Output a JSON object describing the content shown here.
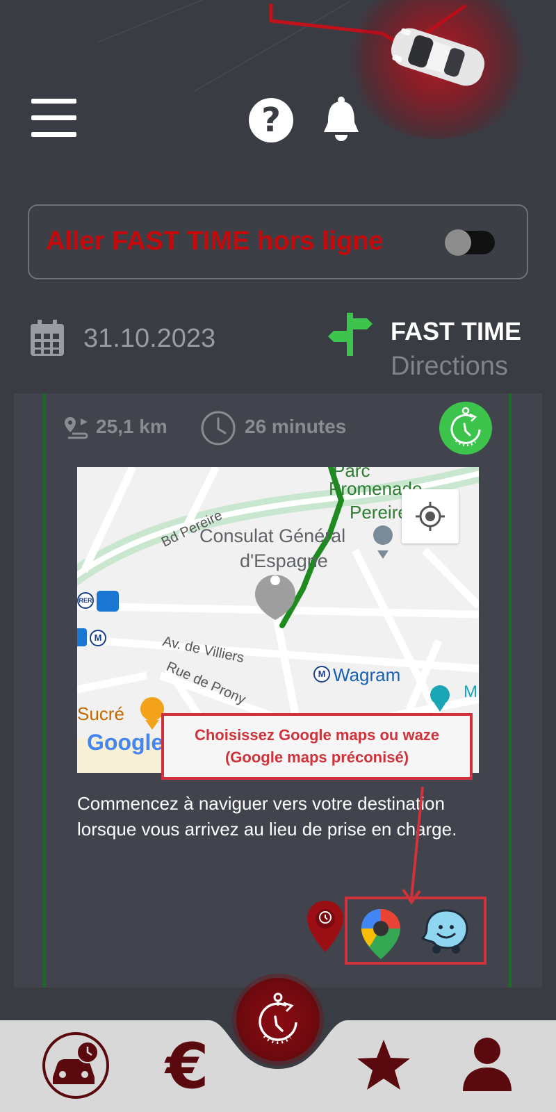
{
  "offline": {
    "label": "Aller FAST TIME hors ligne",
    "toggle_on": false
  },
  "header": {
    "date": "31.10.2023",
    "brand_line1": "FAST TIME",
    "brand_line2": "Directions"
  },
  "trip": {
    "distance": "25,1 km",
    "duration": "26 minutes",
    "instructions": "Commencez à naviguer vers votre destination lorsque vous arrivez au lieu de prise en charge."
  },
  "map": {
    "labels": {
      "parc": "Parc",
      "promenade": "Promenade",
      "pereire_small": "Pereire",
      "bd_pereire": "Bd Pereire",
      "consulat_1": "Consulat Général",
      "consulat_2": "d'Espagne",
      "av_villiers": "Av. de Villiers",
      "rue_prony": "Rue de Prony",
      "wagram": "Wagram",
      "sucre": "Sucré",
      "google": "Google",
      "rer": "RER",
      "metro": "M",
      "m_right": "M"
    },
    "callout_line1": "Choisissez Google maps ou waze",
    "callout_line2": "(Google maps préconisé)"
  },
  "nav_apps": [
    "fast-time-pin-icon",
    "google-maps-icon",
    "waze-icon"
  ],
  "bottom_nav": {
    "items": [
      "car-timer-icon",
      "euro-icon",
      "stopwatch-icon",
      "star-icon",
      "user-icon"
    ],
    "euro_glyph": "€"
  },
  "colors": {
    "background": "#3a3c44",
    "accent_red": "#c40a0a",
    "callout_red": "#d0323c",
    "route_green": "#1e8a20",
    "brand_green": "#3dc44d",
    "nav_maroon": "#5a0a0e"
  }
}
